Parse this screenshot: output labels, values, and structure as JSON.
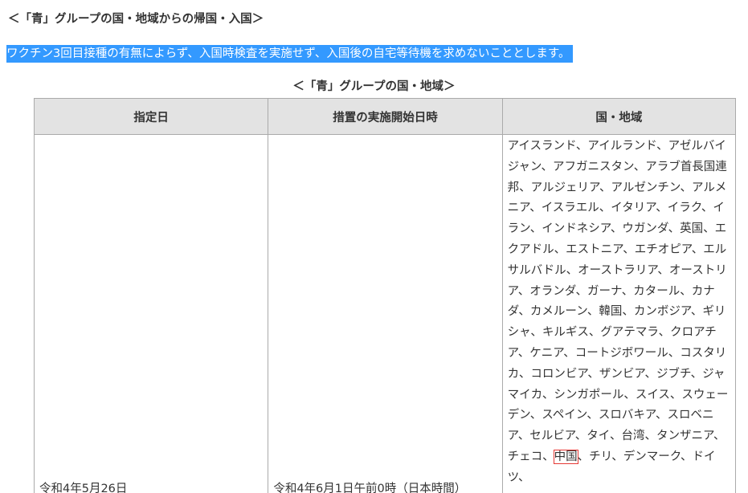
{
  "heading": "＜「青」グループの国・地域からの帰国・入国＞",
  "notice": "ワクチン3回目接種の有無によらず、入国時検査を実施せず、入国後の自宅等待機を求めないこととします。",
  "table": {
    "caption": "＜「青」グループの国・地域＞",
    "headers": [
      "指定日",
      "措置の実施開始日時",
      "国・地域"
    ],
    "row": {
      "designation_date": "令和4年5月26日",
      "start_datetime": "令和4年6月1日午前0時（日本時間）",
      "countries_before": "アイスランド、アイルランド、アゼルバイジャン、アフガニスタン、アラブ首長国連邦、アルジェリア、アルゼンチン、アルメニア、イスラエル、イタリア、イラク、イラン、インドネシア、ウガンダ、英国、エクアドル、エストニア、エチオピア、エルサルバドル、オーストラリア、オーストリア、オランダ、ガーナ、カタール、カナダ、カメルーン、韓国、カンボジア、ギリシャ、キルギス、グアテマラ、クロアチア、ケニア、コートジボワール、コスタリカ、コロンビア、ザンビア、ジブチ、ジャマイカ、シンガポール、スイス、スウェーデン、スペイン、スロバキア、スロベニア、セルビア、タイ、台湾、タンザニア、チェコ、",
      "country_marked": "中国",
      "countries_after": "、チリ、デンマーク、ドイツ、"
    }
  },
  "colors": {
    "highlight": "#3399ff",
    "header_bg": "#e3e3e3",
    "mark_border": "#e53935"
  }
}
